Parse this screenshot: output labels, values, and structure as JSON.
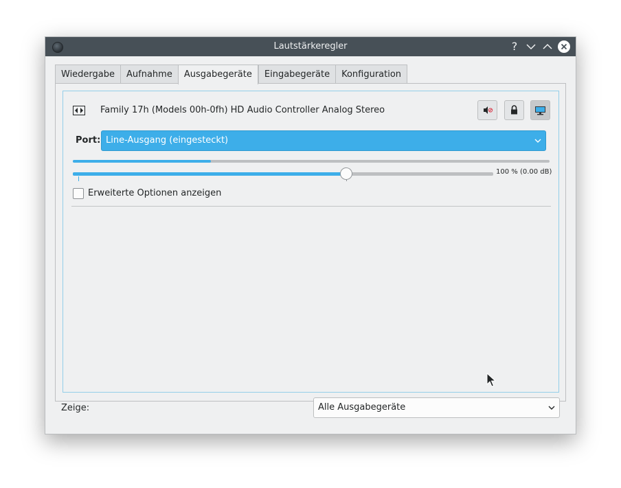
{
  "window": {
    "title": "Lautstärkeregler"
  },
  "titlebar": {
    "help": "?"
  },
  "tabs": [
    {
      "label": "Wiedergabe"
    },
    {
      "label": "Aufnahme"
    },
    {
      "label": "Ausgabegeräte"
    },
    {
      "label": "Eingabegeräte"
    },
    {
      "label": "Konfiguration"
    }
  ],
  "active_tab": "Ausgabegeräte",
  "device": {
    "name": "Family 17h (Models 00h-0fh) HD Audio Controller Analog Stereo",
    "port_label": "Port:",
    "port_value": "Line-Ausgang (eingesteckt)",
    "peak_level": 0.29,
    "volume_fraction": 0.65,
    "volume_text": "100 % (0.00 dB)",
    "advanced_label": "Erweiterte Optionen anzeigen",
    "advanced_checked": false
  },
  "footer": {
    "show_label": "Zeige:",
    "show_value": "Alle Ausgabegeräte"
  },
  "colors": {
    "accent": "#3daee9",
    "titlebar": "#475057",
    "window_bg": "#eff0f1"
  }
}
